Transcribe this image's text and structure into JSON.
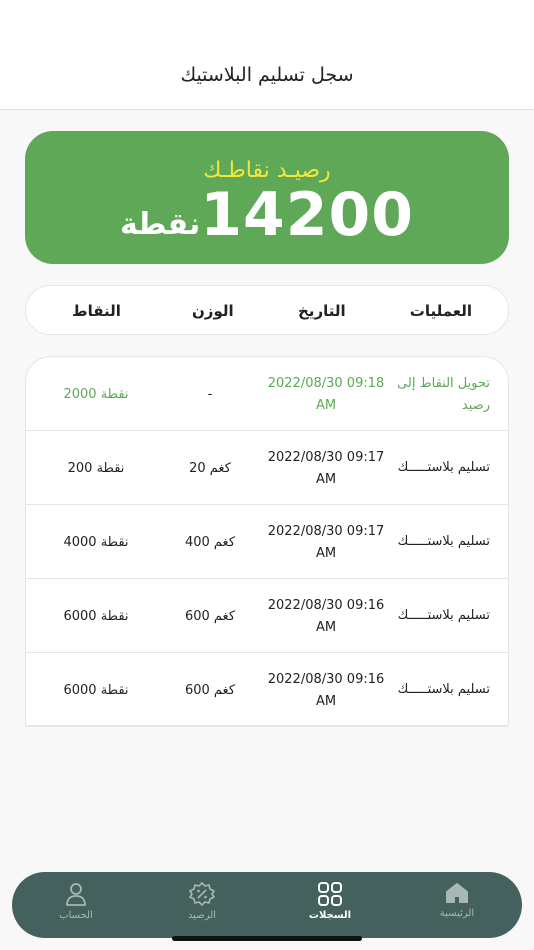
{
  "header": {
    "title": "سجل تسليم البلاستيك"
  },
  "balance": {
    "label": "رصيـد نقاطـك",
    "value": "14200",
    "unit": "نقطة"
  },
  "columns": {
    "operations": "العمليات",
    "date": "التاريخ",
    "weight": "الوزن",
    "points": "النقاط"
  },
  "rows": [
    {
      "operation": "تحويل النقاط إلى رصيد",
      "date": "2022/08/30 09:18 AM",
      "weight": "-",
      "points": "2000 نقطة"
    },
    {
      "operation": "تسليم بلاستـــــك",
      "date": "2022/08/30 09:17 AM",
      "weight": "20 كغم",
      "points": "200 نقطة"
    },
    {
      "operation": "تسليم بلاستـــــك",
      "date": "2022/08/30 09:17 AM",
      "weight": "400 كغم",
      "points": "4000 نقطة"
    },
    {
      "operation": "تسليم بلاستـــــك",
      "date": "2022/08/30 09:16 AM",
      "weight": "600 كغم",
      "points": "6000 نقطة"
    },
    {
      "operation": "تسليم بلاستـــــك",
      "date": "2022/08/30 09:16 AM",
      "weight": "600 كغم",
      "points": "6000 نقطة"
    }
  ],
  "nav": {
    "home": "الرئيسية",
    "records": "السجلات",
    "balance": "الرصيد",
    "account": "الحساب"
  },
  "colors": {
    "accent": "#5ea858",
    "highlight": "#f5e63a",
    "nav_bg": "#44615e"
  }
}
